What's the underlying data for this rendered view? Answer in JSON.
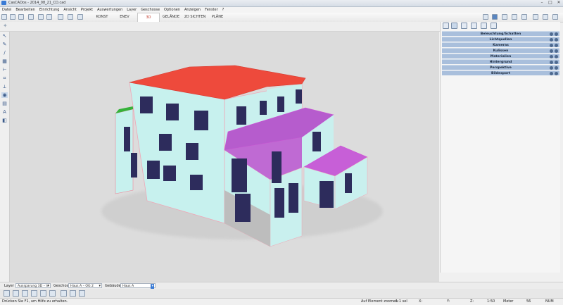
{
  "window": {
    "title": "CasCADos - 2014_08_21_CD.cad",
    "controls": [
      "–",
      "□",
      "✕"
    ]
  },
  "menu": [
    "Datei",
    "Bearbeiten",
    "Einrichtung",
    "Ansicht",
    "Projekt",
    "Auswertungen",
    "Layer",
    "Geschosse",
    "Optionen",
    "Anzeigen",
    "Fenster",
    "?"
  ],
  "tabs": {
    "konst": "KONST",
    "enev": "ENEV",
    "threed": "3D",
    "gelaende": "GELÄNDE",
    "sichten": "2D SICHTEN",
    "plaene": "PLÄNE",
    "active": "3D"
  },
  "right_panel": {
    "rows": [
      "Beleuchtung/Schatten",
      "Lichtquellen",
      "Kameras",
      "Kulissen",
      "Materialien",
      "Hintergrund",
      "Perspektive",
      "Bildexport"
    ]
  },
  "layer_bar": {
    "layer_label": "Layer",
    "layer_value": "Aussparung 3D – V",
    "geschoss_label": "Geschosse",
    "geschoss_value": "Haus A – OG 2",
    "gebaeude_label": "Gebäude",
    "gebaeude_value": "Haus A"
  },
  "status": {
    "help": "Drücken Sie F1, um Hilfe zu erhalten.",
    "mode": "Auf Element zoomen",
    "selection": "1:1 sel",
    "x_label": "X:",
    "y_label": "Y:",
    "z_label": "Z:",
    "scale": "1:50",
    "unit": "Meter",
    "count": "56",
    "num": "NUM"
  },
  "colors": {
    "roof": "#ee4a3c",
    "terrace": "#b65ccd",
    "wall": "#c7f1ee",
    "window": "#2d2c5c",
    "viewport_bg": "#dcdcdc",
    "panel_row": "#a9bfdc"
  }
}
